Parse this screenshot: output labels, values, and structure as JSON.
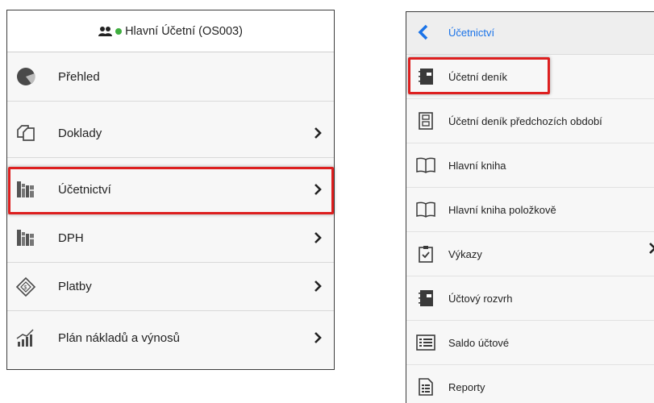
{
  "left": {
    "header_title": "Hlavní Účetní (OS003)",
    "items": [
      {
        "label": "Přehled",
        "icon": "pie-chart-icon",
        "has_chevron": false
      },
      {
        "label": "Doklady",
        "icon": "documents-icon",
        "has_chevron": true
      },
      {
        "label": "Účetnictví",
        "icon": "books-icon",
        "has_chevron": true,
        "highlighted": true
      },
      {
        "label": "DPH",
        "icon": "books-icon",
        "has_chevron": true
      },
      {
        "label": "Platby",
        "icon": "payment-card-icon",
        "has_chevron": true
      },
      {
        "label": "Plán nákladů a výnosů",
        "icon": "growth-chart-icon",
        "has_chevron": true
      }
    ]
  },
  "right": {
    "header_title": "Účetnictví",
    "items": [
      {
        "label": "Účetní deník",
        "icon": "notebook-icon",
        "highlighted": true
      },
      {
        "label": "Účetní deník předchozích období",
        "icon": "ledger-icon"
      },
      {
        "label": "Hlavní kniha",
        "icon": "open-book-icon"
      },
      {
        "label": "Hlavní kniha položkově",
        "icon": "open-book-icon"
      },
      {
        "label": "Výkazy",
        "icon": "clipboard-check-icon"
      },
      {
        "label": "Účtový rozvrh",
        "icon": "notebook-icon"
      },
      {
        "label": "Saldo účtové",
        "icon": "list-icon"
      },
      {
        "label": "Reporty",
        "icon": "report-icon"
      }
    ]
  },
  "colors": {
    "highlight": "#dd1f1f",
    "link": "#1a73e8",
    "online_status": "#3fae3f",
    "icon": "#4a4a4a"
  }
}
